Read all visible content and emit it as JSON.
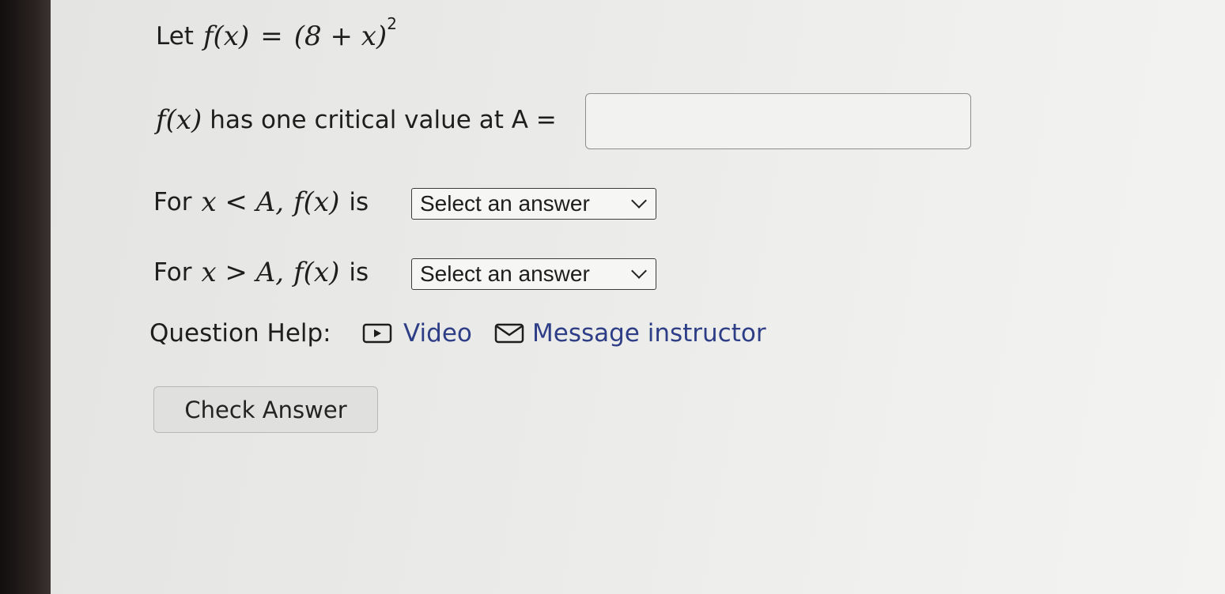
{
  "problem": {
    "intro_word": "Let",
    "function_lhs": "f(x)",
    "equals": "=",
    "function_rhs": "(8 + x)",
    "exponent": "2"
  },
  "critical_value": {
    "func": "f(x)",
    "label": "has one critical value at A =",
    "input_value": ""
  },
  "interval_left": {
    "for_word": "For",
    "condition": "x < A,",
    "func": "f(x)",
    "is_word": "is",
    "select_value": "Select an answer"
  },
  "interval_right": {
    "for_word": "For",
    "condition": "x > A,",
    "func": "f(x)",
    "is_word": "is",
    "select_value": "Select an answer"
  },
  "help": {
    "label": "Question Help:",
    "video_label": "Video",
    "video_icon": "video-icon",
    "message_label": "Message instructor",
    "message_icon": "envelope-icon"
  },
  "check_button": {
    "label": "Check Answer"
  }
}
